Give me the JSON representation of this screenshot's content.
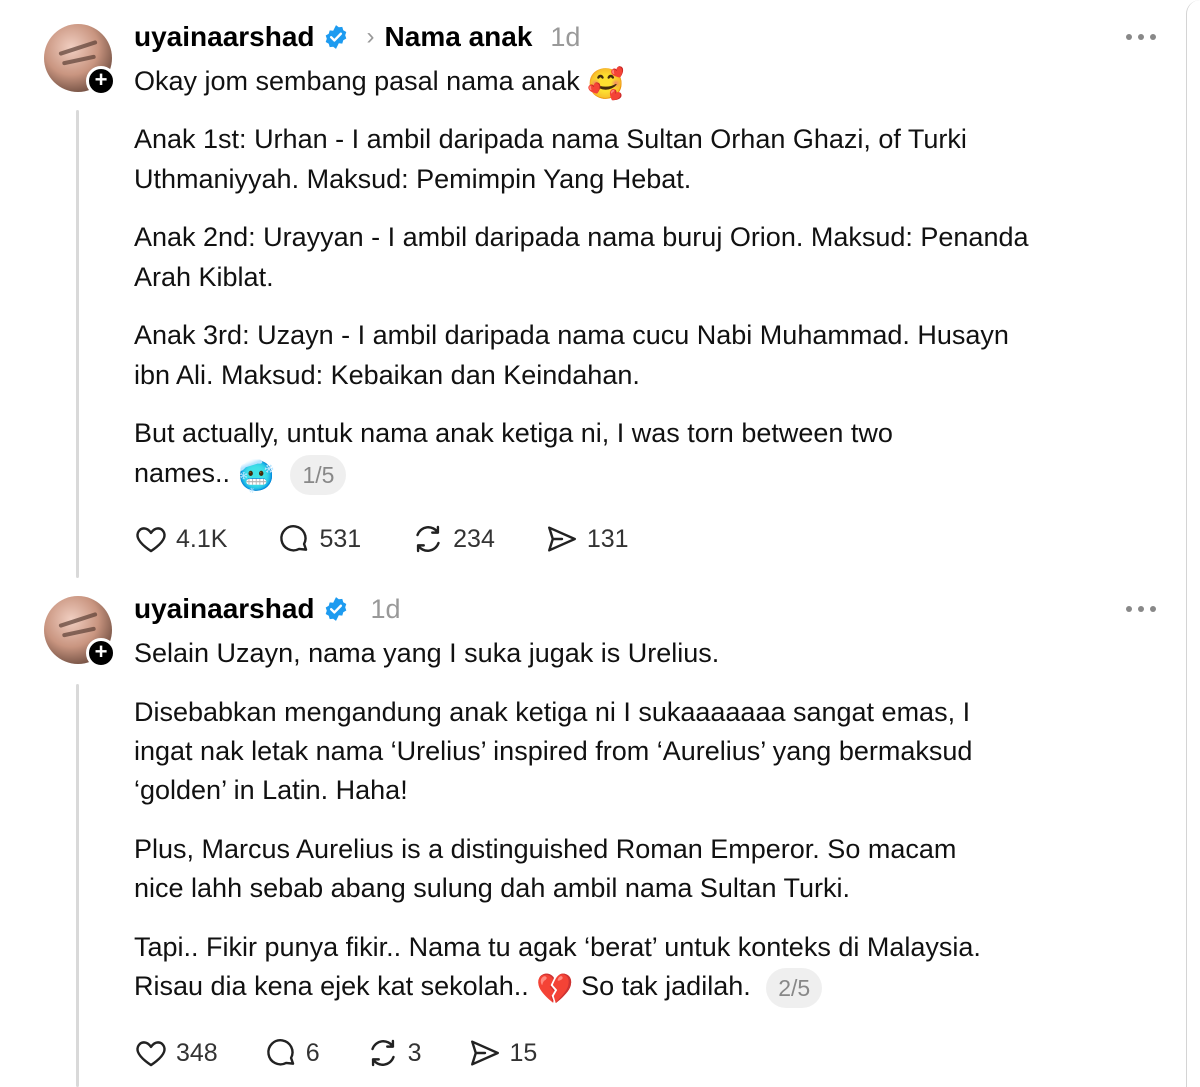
{
  "posts": [
    {
      "username": "uyainaarshad",
      "crumb": "Nama anak",
      "time": "1d",
      "paragraphs": [
        "Okay jom sembang pasal nama anak",
        "Anak 1st: Urhan - I ambil daripada nama Sultan Orhan Ghazi, of Turki",
        "Uthmaniyyah. Maksud: Pemimpin Yang Hebat.",
        "Anak 2nd: Urayyan - I ambil daripada nama buruj Orion. Maksud: Penanda",
        "Arah Kiblat.",
        "Anak 3rd: Uzayn - I ambil daripada nama cucu Nabi Muhammad. Husayn",
        "ibn Ali. Maksud: Kebaikan dan Keindahan.",
        "But actually, untuk nama anak ketiga ni, I was torn between two",
        "names.."
      ],
      "emoji_1": "🥰",
      "emoji_2": "🥶",
      "counter": "1/5",
      "likes": "4.1K",
      "replies": "531",
      "reposts": "234",
      "shares": "131"
    },
    {
      "username": "uyainaarshad",
      "time": "1d",
      "paragraphs": [
        "Selain Uzayn, nama yang I suka jugak is Urelius.",
        "Disebabkan mengandung anak ketiga ni I sukaaaaaaa sangat emas, I",
        "ingat nak letak nama ‘Urelius’ inspired from ‘Aurelius’ yang bermaksud",
        "‘golden’ in Latin. Haha!",
        "Plus, Marcus Aurelius is a distinguished Roman Emperor. So macam",
        "nice lahh sebab abang sulung dah ambil nama Sultan Turki.",
        "Tapi.. Fikir punya fikir.. Nama tu agak ‘berat’ untuk konteks di Malaysia.",
        "Risau dia kena ejek kat sekolah..",
        "So tak jadilah."
      ],
      "emoji_1": "💔",
      "counter": "2/5",
      "likes": "348",
      "replies": "6",
      "reposts": "3",
      "shares": "15"
    }
  ],
  "icons": {
    "verified": "verified-badge-icon",
    "more": "more-options-icon",
    "like": "heart-icon",
    "reply": "comment-icon",
    "repost": "repost-icon",
    "share": "share-icon",
    "follow": "plus-icon"
  },
  "colors": {
    "verified": "#1d9bf0",
    "muted": "#999999",
    "thread_line": "#d9d9d9"
  }
}
